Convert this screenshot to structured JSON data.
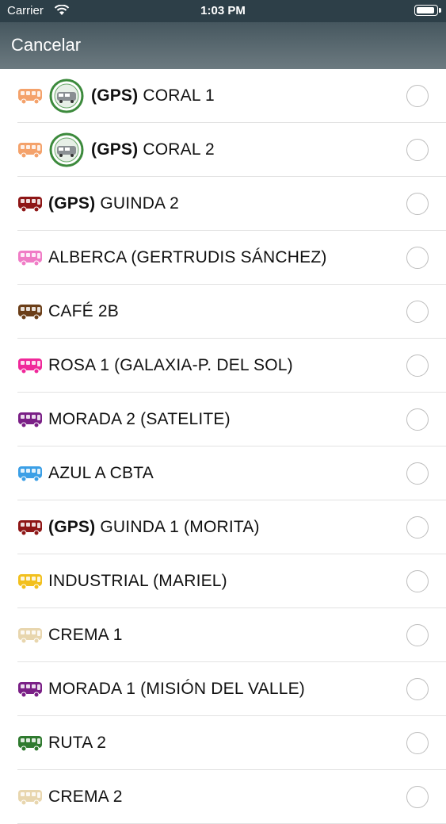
{
  "status_bar": {
    "carrier": "Carrier",
    "time": "1:03 PM",
    "battery_level": 1.0
  },
  "nav": {
    "cancel_label": "Cancelar"
  },
  "colors": {
    "status_bg": "#2d3f48",
    "nav_bg": "#56656c",
    "radio_border": "#bdbdbd"
  },
  "routes": [
    {
      "gps": "(GPS)",
      "name": "CORAL 1",
      "bus_color": "#f4a26b",
      "has_logo": true
    },
    {
      "gps": "(GPS)",
      "name": "CORAL 2",
      "bus_color": "#f4a26b",
      "has_logo": true
    },
    {
      "gps": "(GPS)",
      "name": "GUINDA 2",
      "bus_color": "#8e1616",
      "has_logo": false
    },
    {
      "gps": "",
      "name": "ALBERCA (GERTRUDIS SÁNCHEZ)",
      "bus_color": "#f07cc6",
      "has_logo": false
    },
    {
      "gps": "",
      "name": "CAFÉ 2B",
      "bus_color": "#6b3e18",
      "has_logo": false
    },
    {
      "gps": "",
      "name": "ROSA 1 (GALAXIA-P. DEL SOL)",
      "bus_color": "#f0289a",
      "has_logo": false
    },
    {
      "gps": "",
      "name": "MORADA 2 (SATELITE)",
      "bus_color": "#7a1f86",
      "has_logo": false
    },
    {
      "gps": "",
      "name": "AZUL A CBTA",
      "bus_color": "#3b9fe6",
      "has_logo": false
    },
    {
      "gps": "(GPS)",
      "name": "GUINDA 1 (MORITA)",
      "bus_color": "#8e1616",
      "has_logo": false
    },
    {
      "gps": "",
      "name": "INDUSTRIAL (MARIEL)",
      "bus_color": "#f2c01e",
      "has_logo": false
    },
    {
      "gps": "",
      "name": "CREMA 1",
      "bus_color": "#e8d6ae",
      "has_logo": false
    },
    {
      "gps": "",
      "name": "MORADA 1 (MISIÓN DEL VALLE)",
      "bus_color": "#7a1f86",
      "has_logo": false
    },
    {
      "gps": "",
      "name": "RUTA 2",
      "bus_color": "#2f7a2f",
      "has_logo": false
    },
    {
      "gps": "",
      "name": "CREMA 2",
      "bus_color": "#e8d6ae",
      "has_logo": false
    }
  ]
}
